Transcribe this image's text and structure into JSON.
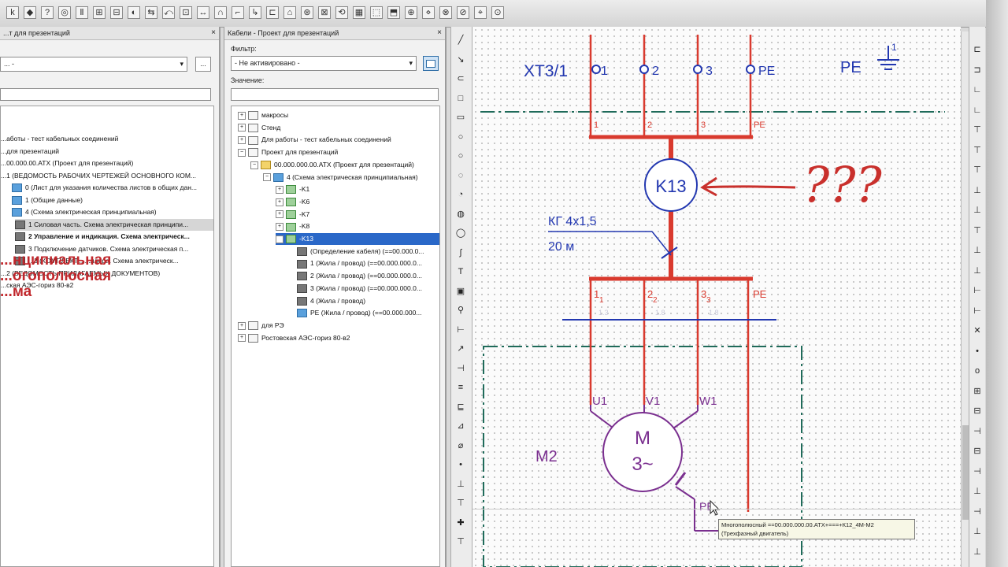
{
  "toolbar": {
    "buttons": [
      "k",
      "◆",
      "?",
      "◎",
      "Ⅱ",
      "⊞",
      "⊟",
      "◐",
      "⇆",
      "⤺",
      "⊡",
      "↔",
      "∩",
      "⌐",
      "↳",
      "⊏",
      "⌂",
      "⊛",
      "⊠",
      "⟲",
      "▦",
      "⬚",
      "⬒",
      "⊕",
      "⋄",
      "⊗",
      "⊘",
      "⌖",
      "⊙"
    ]
  },
  "left_panel": {
    "title": "...т для презентаций",
    "close": "×",
    "combo_value": "... -",
    "combo_button": "...",
    "tree": [
      "...аботы - тест кабельных соединений",
      "...для презентаций",
      "...00.000.00.АТХ (Проект для презентаций)",
      "...1 (ВЕДОМОСТЬ РАБОЧИХ ЧЕРТЕЖЕЙ ОСНОВНОГО КОМ...",
      "0 (Лист для указания количества листов в общих дан...",
      "1 (Общие данные)",
      "4 (Схема электрическая  принципиальная)",
      "1 Силовая часть. Схема электрическая принципи...",
      "2 Управление и индикация. Схема электрическ...",
      "3 Подключение датчиков. Схема электрическая п...",
      "...3 (КОМПЛЕКТ... ...ллера. Схема электрическ...",
      "...2 (ВЕДОМОСТЬ ПРИЛАГАЕМЫХ ДОКУМЕНТОВ)",
      "...ская АЭС-гориз 80-в2"
    ],
    "overlay_red": [
      "...нципиальная",
      "...огополюсная",
      "...ма"
    ]
  },
  "cables_panel": {
    "title": "Кабели - Проект для презентаций",
    "close": "×",
    "filter_label": "Фильтр:",
    "filter_value": "- Не активировано -",
    "value_label": "Значение:",
    "value_input": "",
    "tree": [
      {
        "label": "макросы",
        "indent": 0,
        "exp": "+",
        "icon": "white"
      },
      {
        "label": "Стенд",
        "indent": 0,
        "exp": "+",
        "icon": "white"
      },
      {
        "label": "Для работы - тест кабельных соединений",
        "indent": 0,
        "exp": "+",
        "icon": "white"
      },
      {
        "label": "Проект для презентаций",
        "indent": 0,
        "exp": "−",
        "icon": "white"
      },
      {
        "label": "00.000.000.00.АТХ (Проект для презентаций)",
        "indent": 1,
        "exp": "−",
        "icon": "yellow"
      },
      {
        "label": "4 (Схема электрическая  принципиальная)",
        "indent": 2,
        "exp": "−",
        "icon": "blue"
      },
      {
        "label": "-K1",
        "indent": 3,
        "exp": "+",
        "icon": "green"
      },
      {
        "label": "-K6",
        "indent": 3,
        "exp": "+",
        "icon": "green"
      },
      {
        "label": "-K7",
        "indent": 3,
        "exp": "+",
        "icon": "green"
      },
      {
        "label": "-K8",
        "indent": 3,
        "exp": "+",
        "icon": "green"
      },
      {
        "label": "-K13",
        "indent": 3,
        "exp": "−",
        "icon": "green",
        "selected": true
      },
      {
        "label": "(Определение кабеля) (==00.000.0...",
        "indent": 4,
        "exp": "",
        "icon": "dark"
      },
      {
        "label": "1 (Жила / провод) (==00.000.000.0...",
        "indent": 4,
        "exp": "",
        "icon": "dark"
      },
      {
        "label": "2 (Жила / провод) (==00.000.000.0...",
        "indent": 4,
        "exp": "",
        "icon": "dark"
      },
      {
        "label": "3 (Жила / провод) (==00.000.000.0...",
        "indent": 4,
        "exp": "",
        "icon": "dark"
      },
      {
        "label": "4 (Жила / провод)",
        "indent": 4,
        "exp": "",
        "icon": "dark"
      },
      {
        "label": "PE (Жила / провод) (==00.000.000...",
        "indent": 4,
        "exp": "",
        "icon": "blue"
      },
      {
        "label": "для РЭ",
        "indent": 0,
        "exp": "+",
        "icon": "white"
      },
      {
        "label": "Ростовская АЭС-гориз 80-в2",
        "indent": 0,
        "exp": "+",
        "icon": "white"
      }
    ]
  },
  "draw_tools": [
    "╱",
    "↘",
    "⊂",
    "□",
    "▭",
    "○",
    "○",
    "◌",
    "◔",
    "◍",
    "◯",
    "∫",
    "T",
    "▣",
    "⚲",
    "⊢",
    "↗",
    "⊣",
    "≡",
    "⊑",
    "⊿",
    "⌀",
    "•",
    "⊥",
    "⊤",
    "✚",
    "⊤"
  ],
  "right_tools": [
    "⊏",
    "⊐",
    "∟",
    "∟",
    "⊤",
    "⊤",
    "⊤",
    "⊥",
    "⊥",
    "⊤",
    "⊥",
    "⊥",
    "⊢",
    "⊢",
    "✕",
    "•",
    "o",
    "⊞",
    "⊟",
    "⊣",
    "⊟",
    "⊣",
    "⊥",
    "⊣",
    "⊥",
    "⊥"
  ],
  "schematic": {
    "terminal_label": "XT3/1",
    "terminals": [
      "1",
      "2",
      "3",
      "PE"
    ],
    "wire_labels_top": [
      "1",
      "2",
      "3",
      "PE"
    ],
    "ground_label": "PE",
    "ground_num": "1",
    "cable_device": "K13",
    "handwritten": "???",
    "cable_spec": "КГ 4х1,5",
    "cable_length": "20 м",
    "wire_labels_bottom": [
      "1",
      "2",
      "3",
      "PE"
    ],
    "wire_subs": [
      "1",
      "2",
      "3"
    ],
    "faint_marks": [
      "1.3",
      "1.8",
      "1.8"
    ],
    "motor_label": "M2",
    "motor_symbol": "M",
    "motor_phase": "3~",
    "motor_terminals": [
      "U1",
      "V1",
      "W1",
      "PE"
    ],
    "tooltip_line1": "Многополюсный ==00.000.000.00.АТХ+===+К12_4М-М2",
    "tooltip_line2": "(Трехфазный двигатель)"
  },
  "colors": {
    "wire_red": "#d93a2e",
    "schematic_blue": "#2237b0",
    "motor_purple": "#7a2f8f",
    "frame_teal": "#1f6b5a",
    "selection_blue": "#2a68c8"
  }
}
